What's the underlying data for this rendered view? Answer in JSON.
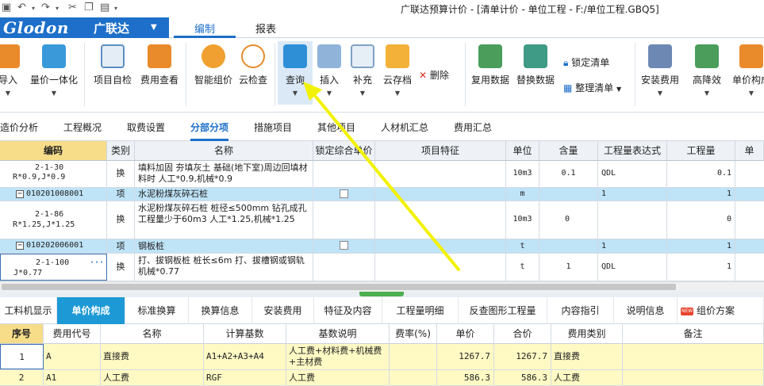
{
  "title": "广联达预算计价 - [清单计价 - 单位工程 - F:/单位工程.GBQ5]",
  "brand": {
    "logo": "Glodon",
    "logo_cn": "广联达",
    "dropdown": "▼"
  },
  "menu_tabs": [
    "编制",
    "报表"
  ],
  "ribbon": {
    "buttons": [
      "导入",
      "量价一体化",
      "项目自检",
      "费用查看",
      "智能组价",
      "云检查",
      "查询",
      "插入",
      "补充",
      "云存档",
      "复用数据",
      "替换数据",
      "安装费用",
      "高降效",
      "单价构成"
    ],
    "delete_label": "删除",
    "lock_label": "锁定清单",
    "organize_label": "整理清单"
  },
  "sub_tabs": [
    "造价分析",
    "工程概况",
    "取费设置",
    "分部分项",
    "措施项目",
    "其他项目",
    "人材机汇总",
    "费用汇总"
  ],
  "grid": {
    "headers": [
      "编码",
      "类别",
      "名称",
      "锁定综合单价",
      "项目特征",
      "单位",
      "含量",
      "工程量表达式",
      "工程量",
      "单"
    ],
    "rows": [
      {
        "code": "2-1-30",
        "code2": "R*0.9,J*0.9",
        "type": "换",
        "name": "填料加固 夯填灰土  基础(地下室)周边回填材料时 人工*0.9,机械*0.9",
        "unit": "10m3",
        "qty": "0.1",
        "expr": "QDL",
        "amount": "0.1",
        "level": "sub"
      },
      {
        "code": "010201008001",
        "type": "项",
        "name": "水泥粉煤灰碎石桩",
        "unit": "m",
        "qty": "",
        "expr": "1",
        "amount": "1",
        "level": "item"
      },
      {
        "code": "2-1-86",
        "code2": "R*1.25,J*1.25",
        "type": "换",
        "name": "水泥粉煤灰碎石桩 桩径≤500mm 钻孔成孔  工程量少于60m3 人工*1.25,机械*1.25",
        "unit": "10m3",
        "qty": "0",
        "expr": "",
        "amount": "0",
        "level": "sub"
      },
      {
        "code": "010202006001",
        "type": "项",
        "name": "钢板桩",
        "unit": "t",
        "qty": "",
        "expr": "1",
        "amount": "1",
        "level": "item"
      },
      {
        "code": "2-1-100",
        "code2": "J*0.77",
        "type": "换",
        "name": "打、拔钢板桩 桩长≤6m  打、拔槽钢或钢轨 机械*0.77",
        "unit": "t",
        "qty": "1",
        "expr": "QDL",
        "amount": "1",
        "level": "sub"
      }
    ]
  },
  "lower_tabs": [
    "工料机显示",
    "单价构成",
    "标准换算",
    "换算信息",
    "安装费用",
    "特征及内容",
    "工程量明细",
    "反查图形工程量",
    "内容指引",
    "说明信息",
    "组价方案"
  ],
  "new_badge": "NEW",
  "lower_grid": {
    "headers": [
      "序号",
      "费用代号",
      "名称",
      "计算基数",
      "基数说明",
      "费率(%)",
      "单价",
      "合价",
      "费用类别",
      "备注"
    ],
    "rows": [
      {
        "no": "1",
        "code": "A",
        "name": "直接费",
        "base": "A1+A2+A3+A4",
        "desc": "人工费+材料费+机械费+主材费",
        "rate": "",
        "price": "1267.7",
        "total": "1267.7",
        "cat": "直接费",
        "note": ""
      },
      {
        "no": "2",
        "code": "A1",
        "name": "人工费",
        "base": "RGF",
        "desc": "人工费",
        "rate": "",
        "price": "586.3",
        "total": "586.3",
        "cat": "人工费",
        "note": ""
      }
    ]
  },
  "colors": {
    "accent": "#1d6fc9",
    "highlight_row": "#bfe3f7",
    "yellow_row": "#fff9c4",
    "active_lower_tab": "#1d9ad6",
    "annotation_arrow": "#f2f200"
  }
}
